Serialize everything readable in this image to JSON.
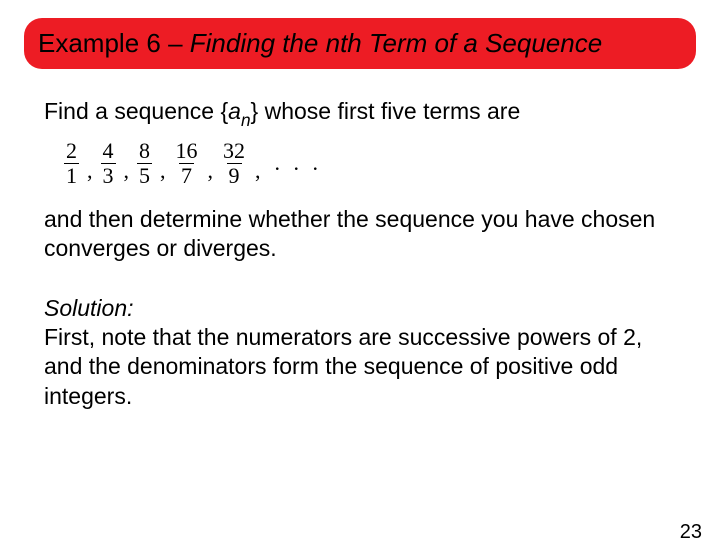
{
  "banner": {
    "prefix": "Example 6 – ",
    "italic_part": "Finding the nth Term of a Sequence"
  },
  "paragraphs": {
    "intro_before_sub": "Find a sequence {",
    "intro_var": "a",
    "intro_sub": "n",
    "intro_after_sub": "} whose first five terms are",
    "middle": "and then determine whether the sequence you have chosen converges or diverges.",
    "solution_label": "Solution:",
    "solution_body": "First, note that the numerators are successive powers of 2, and the denominators form the sequence of positive odd integers."
  },
  "sequence": {
    "terms": [
      {
        "num": "2",
        "den": "1"
      },
      {
        "num": "4",
        "den": "3"
      },
      {
        "num": "8",
        "den": "5"
      },
      {
        "num": "16",
        "den": "7"
      },
      {
        "num": "32",
        "den": "9"
      }
    ],
    "comma": ",",
    "ellipsis": ". . ."
  },
  "page_number": "23"
}
